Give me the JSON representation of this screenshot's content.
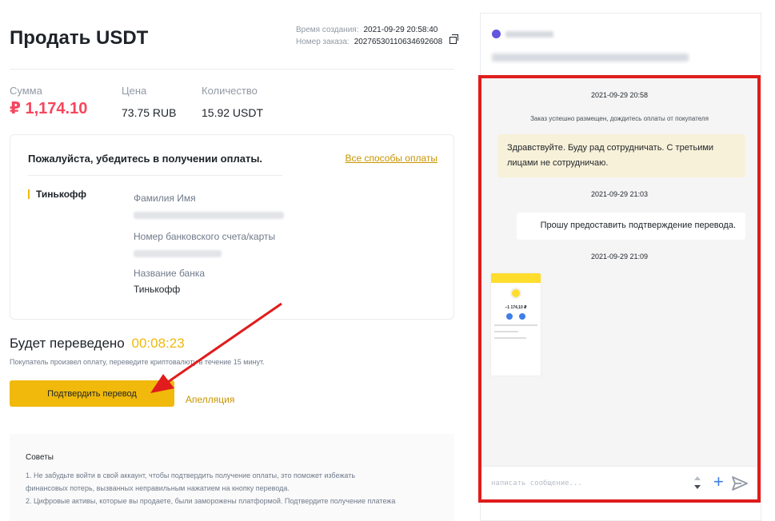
{
  "header": {
    "title": "Продать USDT",
    "created_label": "Время создания:",
    "created_value": "2021-09-29 20:58:40",
    "order_label": "Номер заказа:",
    "order_value": "20276530110634692608"
  },
  "stats": [
    {
      "label": "Сумма",
      "value": "₽ 1,174.10"
    },
    {
      "label": "Цена",
      "value": "73.75 RUB"
    },
    {
      "label": "Количество",
      "value": "15.92 USDT"
    }
  ],
  "payment": {
    "heading": "Пожалуйста, убедитесь в получении оплаты.",
    "all_methods": "Все способы оплаты",
    "bank_tag": "Тинькофф",
    "name_label": "Фамилия Имя",
    "account_label": "Номер банковского счета/карты",
    "bank_label": "Название банка",
    "bank_value": "Тинькофф"
  },
  "timer": {
    "label": "Будет переведено",
    "value": "00:08:23",
    "note": "Покупатель произвел оплату, переведите криптовалюту в течение 15 минут."
  },
  "actions": {
    "confirm": "Подтвердить перевод",
    "appeal": "Апелляция"
  },
  "tips": {
    "title": "Советы",
    "line1": "1. Не забудьте войти в свой аккаунт, чтобы подтвердить получение оплаты, это поможет избежать",
    "line2": "финансовых потерь, вызванных неправильным нажатием на кнопку перевода.",
    "line3": "2. Цифровые активы, которые вы продаете, были заморожены платформой. Подтвердите получение платежа"
  },
  "chat": {
    "ts1": "2021-09-29 20:58",
    "system": "Заказ успешно размещен, дождитесь оплаты от покупателя",
    "msg1": "Здравствуйте. Буду рад сотрудничать. С третьими лицами не сотрудничаю.",
    "ts2": "2021-09-29 21:03",
    "msg2": "Прошу предоставить подтверждение перевода.",
    "ts3": "2021-09-29 21:09",
    "receipt_amount": "−1 174,10 ₽",
    "input_placeholder": "написать сообщение...",
    "plus": "+"
  },
  "colors": {
    "accent": "#f0b90b",
    "amount_red": "#f6465d",
    "highlight_border": "#e01c1c",
    "link_gold": "#c99400"
  }
}
